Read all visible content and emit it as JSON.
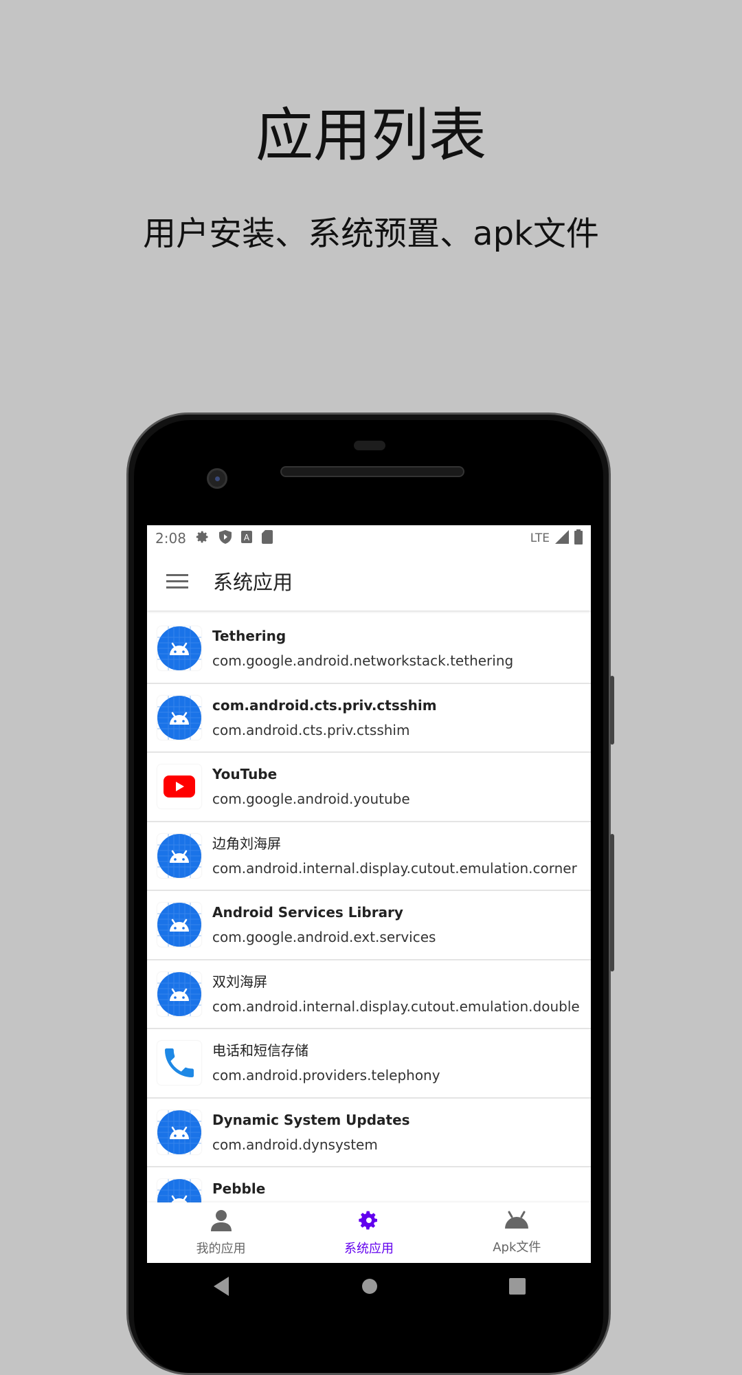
{
  "hero": {
    "title": "应用列表",
    "subtitle": "用户安装、系统预置、apk文件"
  },
  "status_bar": {
    "time": "2:08",
    "icons": [
      "gear-icon",
      "shield-play-icon",
      "a-icon",
      "sd-card-icon"
    ],
    "network": "LTE",
    "right_icons": [
      "signal-icon",
      "battery-icon"
    ]
  },
  "toolbar": {
    "title": "系统应用",
    "menu_icon": "menu-icon"
  },
  "apps": [
    {
      "name": "Tethering",
      "package": "com.google.android.networkstack.tethering",
      "icon": "android"
    },
    {
      "name": "com.android.cts.priv.ctsshim",
      "package": "com.android.cts.priv.ctsshim",
      "icon": "android"
    },
    {
      "name": "YouTube",
      "package": "com.google.android.youtube",
      "icon": "youtube"
    },
    {
      "name": "边角刘海屏",
      "package": "com.android.internal.display.cutout.emulation.corner",
      "icon": "android"
    },
    {
      "name": "Android Services Library",
      "package": "com.google.android.ext.services",
      "icon": "android"
    },
    {
      "name": "双刘海屏",
      "package": "com.android.internal.display.cutout.emulation.double",
      "icon": "android"
    },
    {
      "name": "电话和短信存储",
      "package": "com.android.providers.telephony",
      "icon": "phone"
    },
    {
      "name": "Dynamic System Updates",
      "package": "com.android.dynsystem",
      "icon": "android"
    },
    {
      "name": "Pebble",
      "package": "",
      "icon": "android"
    }
  ],
  "bottom_nav": [
    {
      "label": "我的应用",
      "icon": "person-icon",
      "active": false
    },
    {
      "label": "系统应用",
      "icon": "gear-icon",
      "active": true
    },
    {
      "label": "Apk文件",
      "icon": "android-icon",
      "active": false
    }
  ],
  "colors": {
    "accent": "#6200ee",
    "android_icon": "#1a73e8",
    "youtube": "#ff0000",
    "phone": "#1e88e5",
    "background": "#c4c4c4"
  }
}
